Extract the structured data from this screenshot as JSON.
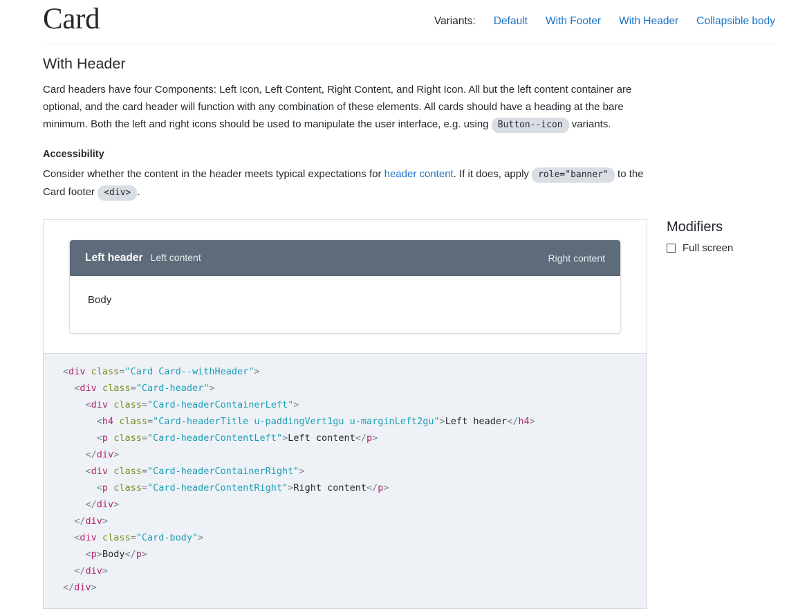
{
  "header": {
    "title": "Card",
    "variants_label": "Variants:",
    "variants": [
      {
        "label": "Default"
      },
      {
        "label": "With Footer"
      },
      {
        "label": "With Header"
      },
      {
        "label": "Collapsible body"
      }
    ]
  },
  "section": {
    "title": "With Header",
    "description_part1": "Card headers have four Components: Left Icon, Left Content, Right Content, and Right Icon. All but the left content container are optional, and the card header will function with any combination of these elements. All cards should have a heading at the bare minimum. Both the left and right icons should be used to manipulate the user interface, e.g. using ",
    "description_code": "Button--icon",
    "description_part2": " variants.",
    "accessibility_title": "Accessibility",
    "a11y_part1": "Consider whether the content in the header meets typical expectations for ",
    "a11y_link": "header content",
    "a11y_part2": ". If it does, apply ",
    "a11y_code1": "role=\"banner\"",
    "a11y_part3": " to the Card footer ",
    "a11y_code2": "<div>",
    "a11y_part4": "."
  },
  "demo_card": {
    "left_header": "Left header",
    "left_content": "Left content",
    "right_content": "Right content",
    "body": "Body",
    "header_bg": "#5d6b7a"
  },
  "code": {
    "lines": [
      [
        {
          "t": "punct",
          "v": "<"
        },
        {
          "t": "tag",
          "v": "div"
        },
        {
          "t": "text",
          "v": " "
        },
        {
          "t": "attr",
          "v": "class"
        },
        {
          "t": "punct",
          "v": "="
        },
        {
          "t": "str",
          "v": "\"Card Card--withHeader\""
        },
        {
          "t": "punct",
          "v": ">"
        }
      ],
      [
        {
          "t": "text",
          "v": "  "
        },
        {
          "t": "punct",
          "v": "<"
        },
        {
          "t": "tag",
          "v": "div"
        },
        {
          "t": "text",
          "v": " "
        },
        {
          "t": "attr",
          "v": "class"
        },
        {
          "t": "punct",
          "v": "="
        },
        {
          "t": "str",
          "v": "\"Card-header\""
        },
        {
          "t": "punct",
          "v": ">"
        }
      ],
      [
        {
          "t": "text",
          "v": "    "
        },
        {
          "t": "punct",
          "v": "<"
        },
        {
          "t": "tag",
          "v": "div"
        },
        {
          "t": "text",
          "v": " "
        },
        {
          "t": "attr",
          "v": "class"
        },
        {
          "t": "punct",
          "v": "="
        },
        {
          "t": "str",
          "v": "\"Card-headerContainerLeft\""
        },
        {
          "t": "punct",
          "v": ">"
        }
      ],
      [
        {
          "t": "text",
          "v": "      "
        },
        {
          "t": "punct",
          "v": "<"
        },
        {
          "t": "tag",
          "v": "h4"
        },
        {
          "t": "text",
          "v": " "
        },
        {
          "t": "attr",
          "v": "class"
        },
        {
          "t": "punct",
          "v": "="
        },
        {
          "t": "str",
          "v": "\"Card-headerTitle u-paddingVert1gu u-marginLeft2gu\""
        },
        {
          "t": "punct",
          "v": ">"
        },
        {
          "t": "text",
          "v": "Left header"
        },
        {
          "t": "punct",
          "v": "</"
        },
        {
          "t": "tag",
          "v": "h4"
        },
        {
          "t": "punct",
          "v": ">"
        }
      ],
      [
        {
          "t": "text",
          "v": "      "
        },
        {
          "t": "punct",
          "v": "<"
        },
        {
          "t": "tag",
          "v": "p"
        },
        {
          "t": "text",
          "v": " "
        },
        {
          "t": "attr",
          "v": "class"
        },
        {
          "t": "punct",
          "v": "="
        },
        {
          "t": "str",
          "v": "\"Card-headerContentLeft\""
        },
        {
          "t": "punct",
          "v": ">"
        },
        {
          "t": "text",
          "v": "Left content"
        },
        {
          "t": "punct",
          "v": "</"
        },
        {
          "t": "tag",
          "v": "p"
        },
        {
          "t": "punct",
          "v": ">"
        }
      ],
      [
        {
          "t": "text",
          "v": "    "
        },
        {
          "t": "punct",
          "v": "</"
        },
        {
          "t": "tag",
          "v": "div"
        },
        {
          "t": "punct",
          "v": ">"
        }
      ],
      [
        {
          "t": "text",
          "v": "    "
        },
        {
          "t": "punct",
          "v": "<"
        },
        {
          "t": "tag",
          "v": "div"
        },
        {
          "t": "text",
          "v": " "
        },
        {
          "t": "attr",
          "v": "class"
        },
        {
          "t": "punct",
          "v": "="
        },
        {
          "t": "str",
          "v": "\"Card-headerContainerRight\""
        },
        {
          "t": "punct",
          "v": ">"
        }
      ],
      [
        {
          "t": "text",
          "v": "      "
        },
        {
          "t": "punct",
          "v": "<"
        },
        {
          "t": "tag",
          "v": "p"
        },
        {
          "t": "text",
          "v": " "
        },
        {
          "t": "attr",
          "v": "class"
        },
        {
          "t": "punct",
          "v": "="
        },
        {
          "t": "str",
          "v": "\"Card-headerContentRight\""
        },
        {
          "t": "punct",
          "v": ">"
        },
        {
          "t": "text",
          "v": "Right content"
        },
        {
          "t": "punct",
          "v": "</"
        },
        {
          "t": "tag",
          "v": "p"
        },
        {
          "t": "punct",
          "v": ">"
        }
      ],
      [
        {
          "t": "text",
          "v": "    "
        },
        {
          "t": "punct",
          "v": "</"
        },
        {
          "t": "tag",
          "v": "div"
        },
        {
          "t": "punct",
          "v": ">"
        }
      ],
      [
        {
          "t": "text",
          "v": "  "
        },
        {
          "t": "punct",
          "v": "</"
        },
        {
          "t": "tag",
          "v": "div"
        },
        {
          "t": "punct",
          "v": ">"
        }
      ],
      [
        {
          "t": "text",
          "v": "  "
        },
        {
          "t": "punct",
          "v": "<"
        },
        {
          "t": "tag",
          "v": "div"
        },
        {
          "t": "text",
          "v": " "
        },
        {
          "t": "attr",
          "v": "class"
        },
        {
          "t": "punct",
          "v": "="
        },
        {
          "t": "str",
          "v": "\"Card-body\""
        },
        {
          "t": "punct",
          "v": ">"
        }
      ],
      [
        {
          "t": "text",
          "v": "    "
        },
        {
          "t": "punct",
          "v": "<"
        },
        {
          "t": "tag",
          "v": "p"
        },
        {
          "t": "punct",
          "v": ">"
        },
        {
          "t": "text",
          "v": "Body"
        },
        {
          "t": "punct",
          "v": "</"
        },
        {
          "t": "tag",
          "v": "p"
        },
        {
          "t": "punct",
          "v": ">"
        }
      ],
      [
        {
          "t": "text",
          "v": "  "
        },
        {
          "t": "punct",
          "v": "</"
        },
        {
          "t": "tag",
          "v": "div"
        },
        {
          "t": "punct",
          "v": ">"
        }
      ],
      [
        {
          "t": "punct",
          "v": "</"
        },
        {
          "t": "tag",
          "v": "div"
        },
        {
          "t": "punct",
          "v": ">"
        }
      ]
    ]
  },
  "modifiers": {
    "title": "Modifiers",
    "items": [
      {
        "label": "Full screen",
        "checked": false
      }
    ]
  }
}
